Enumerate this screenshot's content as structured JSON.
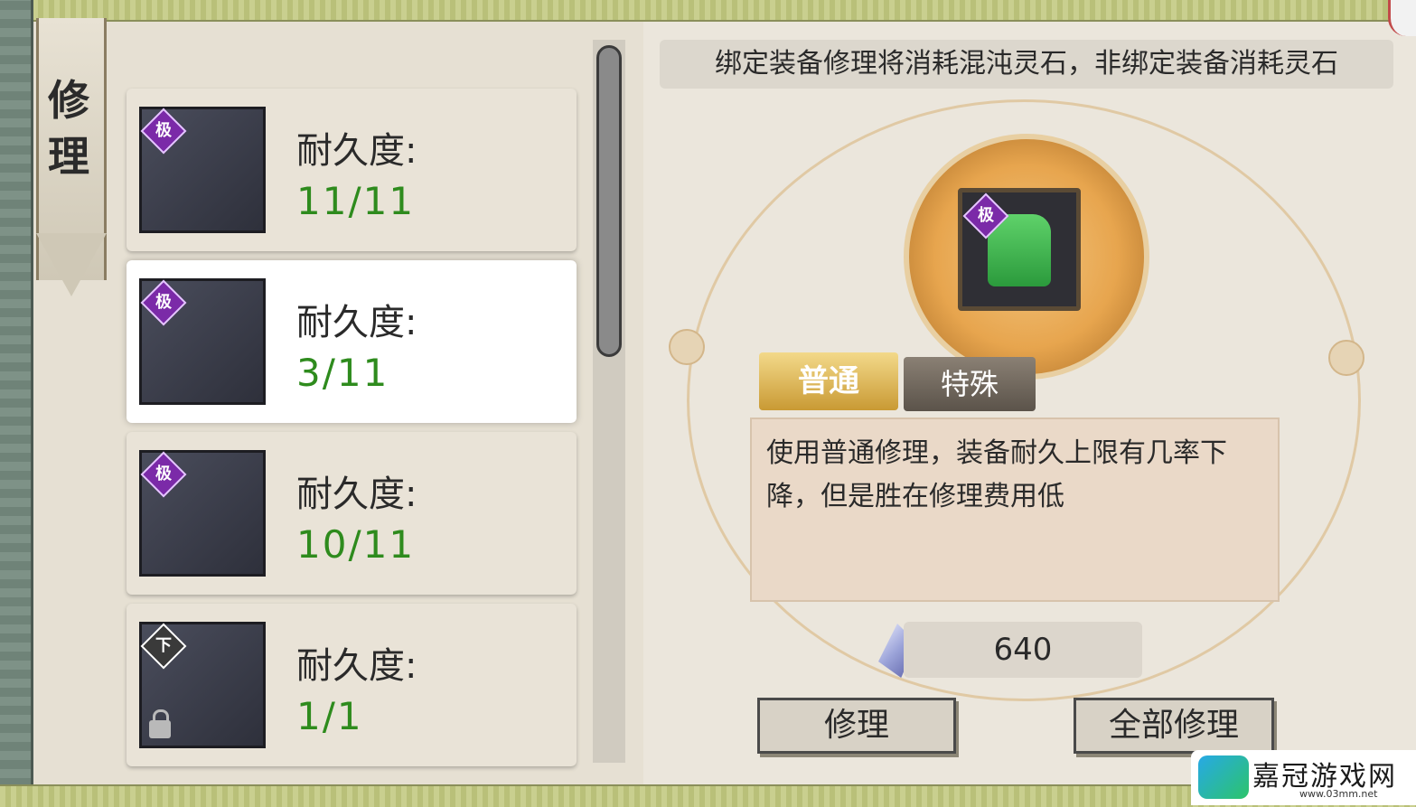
{
  "window": {
    "tab_title": "修\n理"
  },
  "notice": "绑定装备修理将消耗混沌灵石，非绑定装备消耗灵石",
  "items": [
    {
      "grade": "极",
      "durability_label": "耐久度:",
      "durability": "11/11",
      "icon": "sword-icon",
      "locked": false
    },
    {
      "grade": "极",
      "durability_label": "耐久度:",
      "durability": "3/11",
      "icon": "robe-icon",
      "locked": false
    },
    {
      "grade": "极",
      "durability_label": "耐久度:",
      "durability": "10/11",
      "icon": "boots-icon",
      "locked": false
    },
    {
      "grade": "下",
      "durability_label": "耐久度:",
      "durability": "1/1",
      "icon": "pouch-icon",
      "locked": true
    }
  ],
  "detail": {
    "selected_grade": "极",
    "tabs": {
      "normal": "普通",
      "special": "特殊"
    },
    "description": "使用普通修理，装备耐久上限有几率下降，但是胜在修理费用低",
    "cost": "640",
    "repair_label": "修理",
    "repair_all_label": "全部修理"
  },
  "watermark": {
    "text": "嘉冠游戏网",
    "url": "www.03mm.net"
  }
}
